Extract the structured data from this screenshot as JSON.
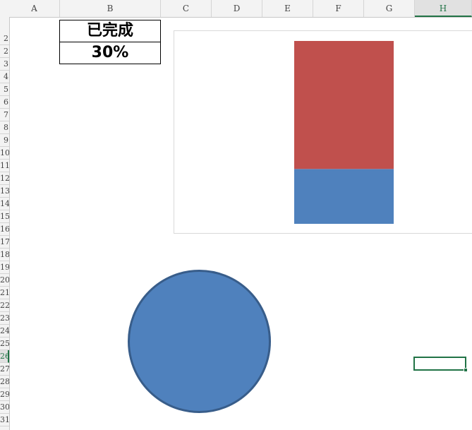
{
  "sheet": {
    "columns": [
      "A",
      "B",
      "C",
      "D",
      "E",
      "F",
      "G",
      "H"
    ],
    "active_column": "H",
    "rows": [
      "2",
      "2",
      "3",
      "4",
      "5",
      "6",
      "7",
      "8",
      "9",
      "10",
      "11",
      "12",
      "13",
      "14",
      "15",
      "16",
      "17",
      "18",
      "19",
      "20",
      "21",
      "22",
      "23",
      "24",
      "25",
      "26",
      "27",
      "28",
      "29",
      "30",
      "31"
    ],
    "active_row": "26"
  },
  "cells": {
    "b1_label": "已完成",
    "b2_value": "30%"
  },
  "chart_data": {
    "type": "bar",
    "stacked": true,
    "categories": [
      ""
    ],
    "series": [
      {
        "values": [
          30
        ],
        "color": "#4f81bd"
      },
      {
        "values": [
          70
        ],
        "color": "#c0504d"
      }
    ],
    "title": "",
    "xlabel": "",
    "ylabel": "",
    "ylim": [
      0,
      100
    ],
    "grid": false,
    "legend": "none"
  },
  "shapes": {
    "circle": {
      "fill": "#4f81bd",
      "stroke": "#385d8a"
    }
  }
}
